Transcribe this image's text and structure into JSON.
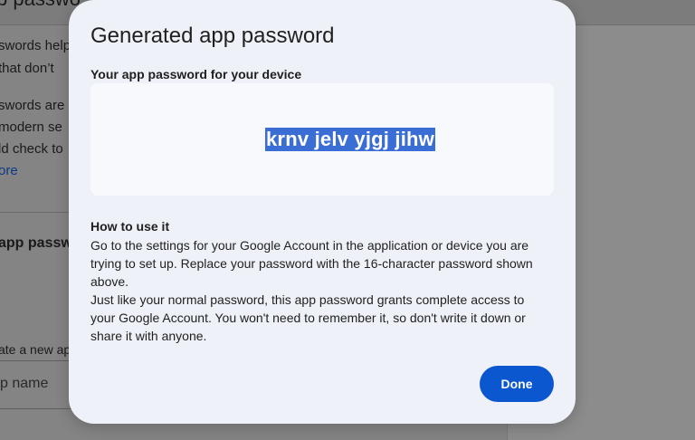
{
  "background": {
    "title_fragment": "p passwo",
    "lines": [
      "swords help",
      "that don’t",
      "swords are",
      "modern se",
      "ld check to"
    ],
    "link_fragment": "ore",
    "section_heading": "app passw",
    "create_fragment": "ate a new ap",
    "input_placeholder": "p name"
  },
  "dialog": {
    "title": "Generated app password",
    "password_label": "Your app password for your device",
    "password": "krnv jelv yjgj jihw",
    "howto_title": "How to use it",
    "howto_paragraphs": [
      "Go to the settings for your Google Account in the application or device you are trying to set up. Replace your password with the 16-character password shown above.",
      "Just like your normal password, this app password grants complete access to your Google Account. You won't need to remember it, so don't write it down or share it with anyone."
    ],
    "done_label": "Done"
  },
  "colors": {
    "accent": "#0b57d0",
    "selection": "#3b6ed4",
    "dialog_bg": "#eef1f8"
  }
}
